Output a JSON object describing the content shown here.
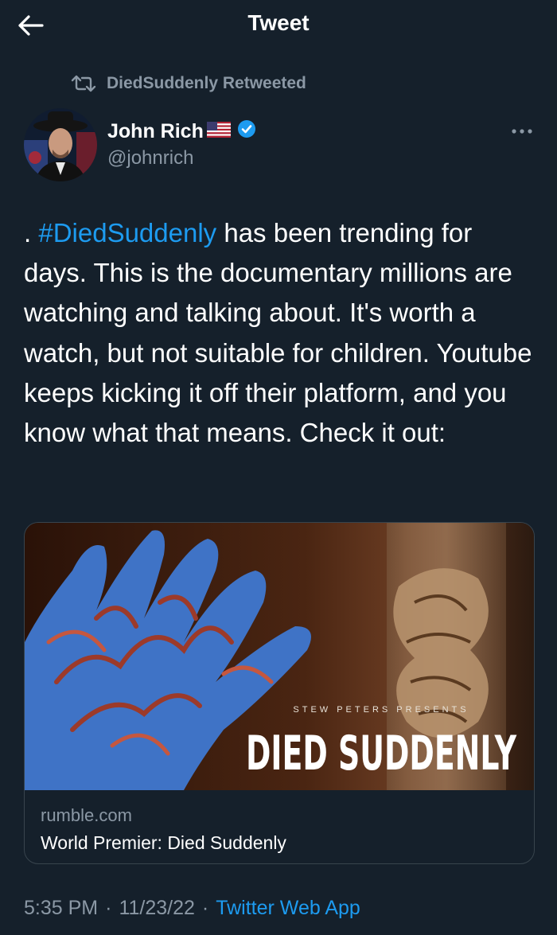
{
  "header": {
    "title": "Tweet",
    "back_icon": "arrow-left-icon"
  },
  "retweet": {
    "text": "DiedSuddenly Retweeted",
    "icon": "retweet-icon"
  },
  "author": {
    "name": "John Rich",
    "handle": "@johnrich",
    "flag_icon": "us-flag-icon",
    "verified_icon": "verified-badge-icon",
    "more_icon": "more-horizontal-icon"
  },
  "tweet": {
    "prefix": ". ",
    "hashtag": "#DiedSuddenly",
    "body": " has been trending for days. This is the documentary millions are watching and talking about. It's worth a watch, but not suitable for children. Youtube keeps kicking it off their platform, and you know what that means. Check it out:"
  },
  "card": {
    "image_subtitle": "STEW PETERS PRESENTS",
    "image_title": "DIED SUDDENLY",
    "domain": "rumble.com",
    "title": "World Premier: Died Suddenly"
  },
  "meta": {
    "time": "5:35 PM",
    "separator": "·",
    "date": "11/23/22",
    "source": "Twitter Web App"
  },
  "colors": {
    "background": "#15202b",
    "text": "#ffffff",
    "secondary": "#8b98a5",
    "accent": "#1d9bf0",
    "border": "#38444d"
  }
}
